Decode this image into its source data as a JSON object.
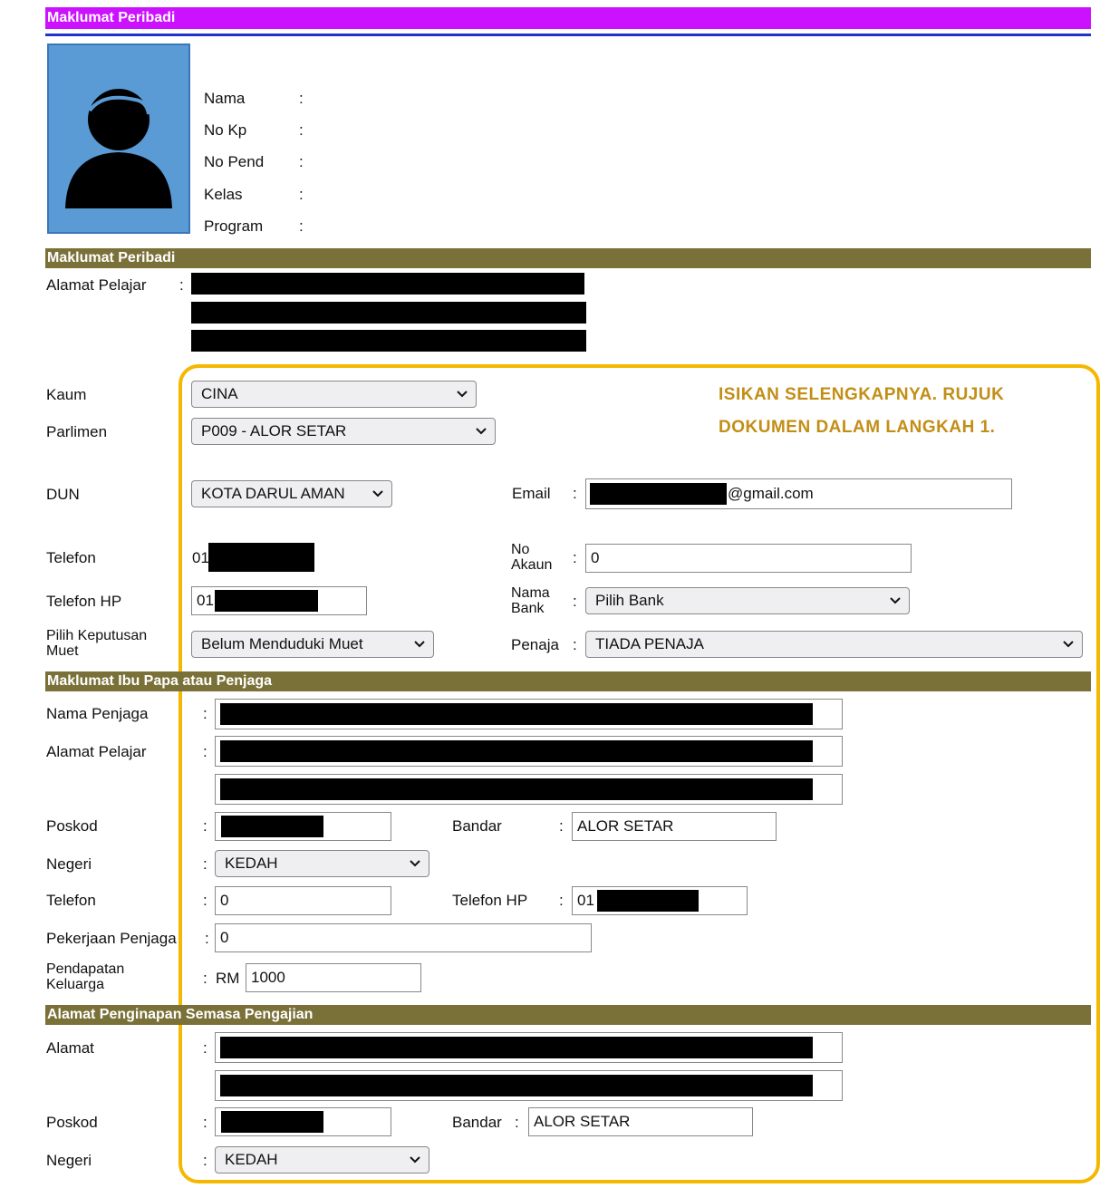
{
  "header": {
    "title": "Maklumat Peribadi"
  },
  "profile": {
    "fields": [
      {
        "label": "Nama",
        "sep": ":"
      },
      {
        "label": "No Kp",
        "sep": ":"
      },
      {
        "label": "No Pend",
        "sep": ":"
      },
      {
        "label": "Kelas",
        "sep": ":"
      },
      {
        "label": "Program",
        "sep": ":"
      }
    ]
  },
  "section1": {
    "title": "Maklumat Peribadi",
    "address_label": "Alamat Pelajar",
    "sep": ":"
  },
  "form": {
    "kaum": {
      "label": "Kaum",
      "value": "CINA"
    },
    "parlimen": {
      "label": "Parlimen",
      "value": "P009 - ALOR SETAR"
    },
    "dun": {
      "label": "DUN",
      "value": "KOTA DARUL AMAN"
    },
    "email": {
      "label": "Email",
      "sep": ":",
      "value": "@gmail.com"
    },
    "telefon": {
      "label": "Telefon",
      "value": "01"
    },
    "no_akaun": {
      "label": "No Akaun",
      "sep": ":",
      "value": "0"
    },
    "telefon_hp": {
      "label": "Telefon HP",
      "value": "01"
    },
    "nama_bank": {
      "label": "Nama Bank",
      "sep": ":",
      "value": "Pilih Bank"
    },
    "muet": {
      "label": "Pilih Keputusan Muet",
      "value": "Belum Menduduki Muet"
    },
    "penaja": {
      "label": "Penaja",
      "sep": ":",
      "value": "TIADA PENAJA"
    }
  },
  "note": {
    "line1": "ISIKAN SELENGKAPNYA. RUJUK",
    "line2": "DOKUMEN DALAM LANGKAH 1."
  },
  "section2": {
    "title": "Maklumat Ibu Papa atau Penjaga",
    "nama_penjaga": {
      "label": "Nama Penjaga",
      "sep": ":"
    },
    "alamat": {
      "label": "Alamat Pelajar",
      "sep": ":"
    },
    "poskod": {
      "label": "Poskod",
      "sep": ":"
    },
    "bandar": {
      "label": "Bandar",
      "sep": ":",
      "value": "ALOR SETAR"
    },
    "negeri": {
      "label": "Negeri",
      "sep": ":",
      "value": "KEDAH"
    },
    "telefon": {
      "label": "Telefon",
      "sep": ":",
      "value": "0"
    },
    "telefon_hp": {
      "label": "Telefon HP",
      "sep": ":",
      "value": "01"
    },
    "pekerjaan": {
      "label": "Pekerjaan Penjaga",
      "sep": ":",
      "value": "0"
    },
    "pendapatan": {
      "label": "Pendapatan Keluarga",
      "sep": ":",
      "prefix": "RM",
      "value": "1000"
    }
  },
  "section3": {
    "title": "Alamat Penginapan Semasa Pengajian",
    "alamat": {
      "label": "Alamat",
      "sep": ":"
    },
    "poskod": {
      "label": "Poskod",
      "sep": ":"
    },
    "bandar": {
      "label": "Bandar",
      "sep": ":",
      "value": "ALOR SETAR"
    },
    "negeri": {
      "label": "Negeri",
      "sep": ":",
      "value": "KEDAH"
    }
  },
  "colors": {
    "purple": "#cc11ff",
    "olive": "#7a7139",
    "highlight": "#f5b800",
    "note": "#c28e16",
    "avatar_bg": "#5b9bd5"
  },
  "icons": [
    "user-avatar-icon",
    "chevron-down-icon"
  ]
}
